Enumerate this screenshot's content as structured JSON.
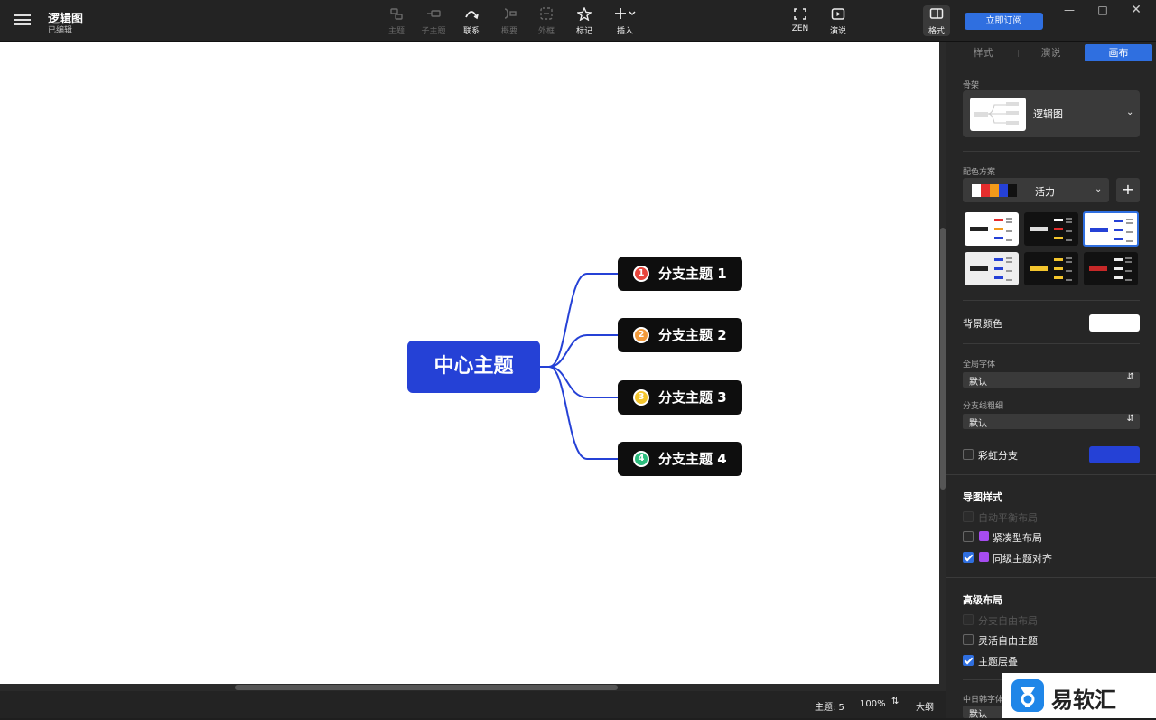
{
  "doc": {
    "title": "逻辑图",
    "status": "已编辑"
  },
  "toolbar": {
    "topic": "主题",
    "subtopic": "子主题",
    "relation": "联系",
    "summary": "概要",
    "boundary": "外框",
    "marker": "标记",
    "insert": "插入",
    "zen": "ZEN",
    "present": "演说",
    "format": "格式"
  },
  "subscribe_label": "立即订阅",
  "mindmap": {
    "center": "中心主题",
    "branches": [
      {
        "num": "1",
        "label": "分支主题 1",
        "color": "#e8453c"
      },
      {
        "num": "2",
        "label": "分支主题 2",
        "color": "#f29a3a"
      },
      {
        "num": "3",
        "label": "分支主题 3",
        "color": "#f3c52d"
      },
      {
        "num": "4",
        "label": "分支主题 4",
        "color": "#2dbd7e"
      }
    ],
    "line_color": "#2541d6",
    "center_color": "#2541d6"
  },
  "statusbar": {
    "topics": "主题: 5",
    "zoom": "100%",
    "outline": "大纲"
  },
  "panel": {
    "tabs": [
      "样式",
      "演说",
      "画布"
    ],
    "active_tab": "画布",
    "skeleton_label": "骨架",
    "skeleton_value": "逻辑图",
    "color_scheme_label": "配色方案",
    "color_scheme_value": "活力",
    "scheme_colors": [
      "#ffffff",
      "#e52d2d",
      "#f29a1a",
      "#2541d6",
      "#111111"
    ],
    "bg_color_label": "背景颜色",
    "bg_color": "#ffffff",
    "global_font_label": "全局字体",
    "global_font_value": "默认",
    "branch_width_label": "分支线粗细",
    "branch_width_value": "默认",
    "rainbow_label": "彩虹分支",
    "rainbow_color": "#2541d6",
    "map_style_heading": "导图样式",
    "auto_balance": "自动平衡布局",
    "compact": "紧凑型布局",
    "align_same_level": "同级主题对齐",
    "advanced_heading": "高级布局",
    "free_branch": "分支自由布局",
    "flexible_free": "灵活自由主题",
    "topic_overlap": "主题层叠",
    "cjk_font_label": "中日韩字体",
    "cjk_font_value": "默认"
  },
  "watermark": "易软汇"
}
